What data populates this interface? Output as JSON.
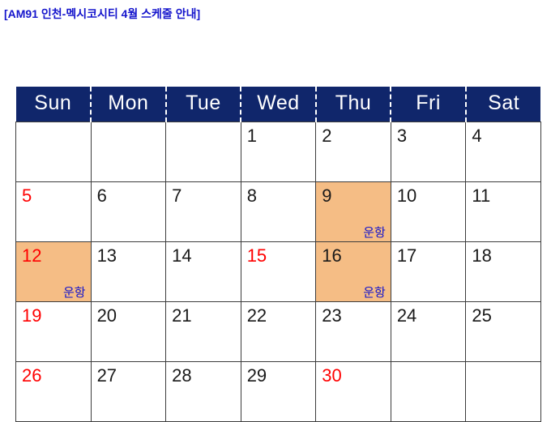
{
  "title": "[AM91 인천-멕시코시티 4월 스케줄 안내]",
  "colors": {
    "title_text": "#1414cc",
    "header_bg": "#10266b",
    "header_text": "#ffffff",
    "holiday_text": "#ff0000",
    "weekday_text": "#1a1a1a",
    "flight_cell_bg": "#f5bd85",
    "note_text": "#1414cc",
    "grid_line": "#3c3c3c"
  },
  "calendar": {
    "weekday_headers": [
      "Sun",
      "Mon",
      "Tue",
      "Wed",
      "Thu",
      "Fri",
      "Sat"
    ],
    "weeks": [
      [
        {
          "day": "",
          "holiday": false,
          "flight": false,
          "note": ""
        },
        {
          "day": "",
          "holiday": false,
          "flight": false,
          "note": ""
        },
        {
          "day": "",
          "holiday": false,
          "flight": false,
          "note": ""
        },
        {
          "day": "1",
          "holiday": false,
          "flight": false,
          "note": ""
        },
        {
          "day": "2",
          "holiday": false,
          "flight": false,
          "note": ""
        },
        {
          "day": "3",
          "holiday": false,
          "flight": false,
          "note": ""
        },
        {
          "day": "4",
          "holiday": false,
          "flight": false,
          "note": ""
        }
      ],
      [
        {
          "day": "5",
          "holiday": true,
          "flight": false,
          "note": ""
        },
        {
          "day": "6",
          "holiday": false,
          "flight": false,
          "note": ""
        },
        {
          "day": "7",
          "holiday": false,
          "flight": false,
          "note": ""
        },
        {
          "day": "8",
          "holiday": false,
          "flight": false,
          "note": ""
        },
        {
          "day": "9",
          "holiday": false,
          "flight": true,
          "note": "운항"
        },
        {
          "day": "10",
          "holiday": false,
          "flight": false,
          "note": ""
        },
        {
          "day": "11",
          "holiday": false,
          "flight": false,
          "note": ""
        }
      ],
      [
        {
          "day": "12",
          "holiday": true,
          "flight": true,
          "note": "운항"
        },
        {
          "day": "13",
          "holiday": false,
          "flight": false,
          "note": ""
        },
        {
          "day": "14",
          "holiday": false,
          "flight": false,
          "note": ""
        },
        {
          "day": "15",
          "holiday": true,
          "flight": false,
          "note": ""
        },
        {
          "day": "16",
          "holiday": false,
          "flight": true,
          "note": "운항"
        },
        {
          "day": "17",
          "holiday": false,
          "flight": false,
          "note": ""
        },
        {
          "day": "18",
          "holiday": false,
          "flight": false,
          "note": ""
        }
      ],
      [
        {
          "day": "19",
          "holiday": true,
          "flight": false,
          "note": ""
        },
        {
          "day": "20",
          "holiday": false,
          "flight": false,
          "note": ""
        },
        {
          "day": "21",
          "holiday": false,
          "flight": false,
          "note": ""
        },
        {
          "day": "22",
          "holiday": false,
          "flight": false,
          "note": ""
        },
        {
          "day": "23",
          "holiday": false,
          "flight": false,
          "note": ""
        },
        {
          "day": "24",
          "holiday": false,
          "flight": false,
          "note": ""
        },
        {
          "day": "25",
          "holiday": false,
          "flight": false,
          "note": ""
        }
      ],
      [
        {
          "day": "26",
          "holiday": true,
          "flight": false,
          "note": ""
        },
        {
          "day": "27",
          "holiday": false,
          "flight": false,
          "note": ""
        },
        {
          "day": "28",
          "holiday": false,
          "flight": false,
          "note": ""
        },
        {
          "day": "29",
          "holiday": false,
          "flight": false,
          "note": ""
        },
        {
          "day": "30",
          "holiday": true,
          "flight": false,
          "note": ""
        },
        {
          "day": "",
          "holiday": false,
          "flight": false,
          "note": ""
        },
        {
          "day": "",
          "holiday": false,
          "flight": false,
          "note": ""
        }
      ]
    ]
  }
}
